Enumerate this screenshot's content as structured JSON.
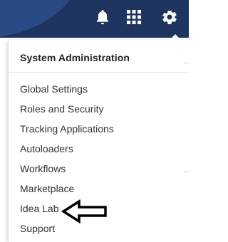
{
  "header": {
    "icons": [
      {
        "name": "bell-icon"
      },
      {
        "name": "apps-grid-icon"
      },
      {
        "name": "gear-icon"
      }
    ],
    "colors": {
      "bar": "#1e355f",
      "brand_shape": "#2a4a86",
      "icon": "#ffffff"
    }
  },
  "menu": {
    "title": "System Administration",
    "items": [
      {
        "label": "Global Settings"
      },
      {
        "label": "Roles and Security"
      },
      {
        "label": "Tracking Applications"
      },
      {
        "label": "Autoloaders"
      },
      {
        "label": "Workflows"
      },
      {
        "label": "Marketplace"
      },
      {
        "label": "Idea Lab"
      },
      {
        "label": "Support"
      }
    ]
  },
  "annotation": {
    "icon": "left-arrow-outline-icon",
    "points_to": "Idea Lab"
  }
}
